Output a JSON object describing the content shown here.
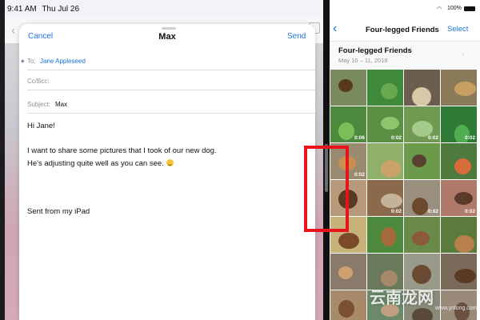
{
  "left": {
    "status": {
      "time": "9:41 AM",
      "date": "Thu Jul 26"
    },
    "compose": {
      "cancel_label": "Cancel",
      "title": "Max",
      "send_label": "Send",
      "to_label": "To:",
      "to_value": "Jane Appleseed",
      "cc_label": "Cc/Bcc:",
      "subject_label": "Subject:",
      "subject_value": "Max",
      "body": {
        "greeting": "Hi Jane!",
        "line1": "I want to share some pictures that I took of our new dog.",
        "line2": "He's adjusting quite well as you can see.",
        "signature": "Sent from my iPad"
      }
    }
  },
  "right": {
    "status": {
      "battery": "100%"
    },
    "nav": {
      "back_label": "‹",
      "title": "Four-legged Friends",
      "select_label": "Select"
    },
    "album": {
      "title": "Four-legged Friends",
      "date_range": "May 10 – 11, 2018"
    },
    "photos": [
      {
        "bg": "#7a8a5c",
        "fg": "#5a3a1f",
        "label": ""
      },
      {
        "bg": "#3f8a3a",
        "fg": "#6aa84f",
        "label": ""
      },
      {
        "bg": "#6b5e4e",
        "fg": "#d8c8a8",
        "label": ""
      },
      {
        "bg": "#8a7a5a",
        "fg": "#c89f62",
        "label": ""
      },
      {
        "bg": "#4e8a3e",
        "fg": "#7bbf5a",
        "label": "0:06"
      },
      {
        "bg": "#5c8f44",
        "fg": "#8ec46e",
        "label": "0:02"
      },
      {
        "bg": "#6f9a52",
        "fg": "#a5c98b",
        "label": "0:02"
      },
      {
        "bg": "#2f7a34",
        "fg": "#4fae4f",
        "label": "0:02"
      },
      {
        "bg": "#9a8a70",
        "fg": "#c98f4f",
        "label": "0:02"
      },
      {
        "bg": "#8fb06a",
        "fg": "#c9a36a",
        "label": ""
      },
      {
        "bg": "#6a9a4a",
        "fg": "#5a4030",
        "label": ""
      },
      {
        "bg": "#4e7a3e",
        "fg": "#d96a3a",
        "label": ""
      },
      {
        "bg": "#b89a7a",
        "fg": "#5a3a22",
        "label": ""
      },
      {
        "bg": "#8a6a4a",
        "fg": "#c4b29a",
        "label": "0:02"
      },
      {
        "bg": "#9a8e7e",
        "fg": "#6a4a2a",
        "label": "0:02"
      },
      {
        "bg": "#b07a6a",
        "fg": "#5a3a2a",
        "label": "0:02"
      },
      {
        "bg": "#c7b27a",
        "fg": "#7a4a2a",
        "label": ""
      },
      {
        "bg": "#4e8a3e",
        "fg": "#a86a3a",
        "label": ""
      },
      {
        "bg": "#6a8a4a",
        "fg": "#8a5a3a",
        "label": ""
      },
      {
        "bg": "#5a7a3e",
        "fg": "#b8804a",
        "label": ""
      },
      {
        "bg": "#8a7a6a",
        "fg": "#d0a070",
        "label": ""
      },
      {
        "bg": "#6a7a5a",
        "fg": "#a88a6a",
        "label": ""
      },
      {
        "bg": "#9a9a8a",
        "fg": "#6a4a32",
        "label": ""
      },
      {
        "bg": "#7a6a5a",
        "fg": "#5a3a22",
        "label": ""
      },
      {
        "bg": "#a68a6a",
        "fg": "#7a5030",
        "label": ""
      },
      {
        "bg": "#6a8a6a",
        "fg": "#c0a080",
        "label": ""
      },
      {
        "bg": "#8a8a7a",
        "fg": "#5a4a3a",
        "label": ""
      },
      {
        "bg": "#9a8a7a",
        "fg": "#6a5040",
        "label": ""
      }
    ]
  },
  "watermark": {
    "brand": "云南龙网",
    "url": "www.ynlong.com"
  },
  "colors": {
    "accent": "#1a73d9",
    "highlight": "#e8141b"
  }
}
